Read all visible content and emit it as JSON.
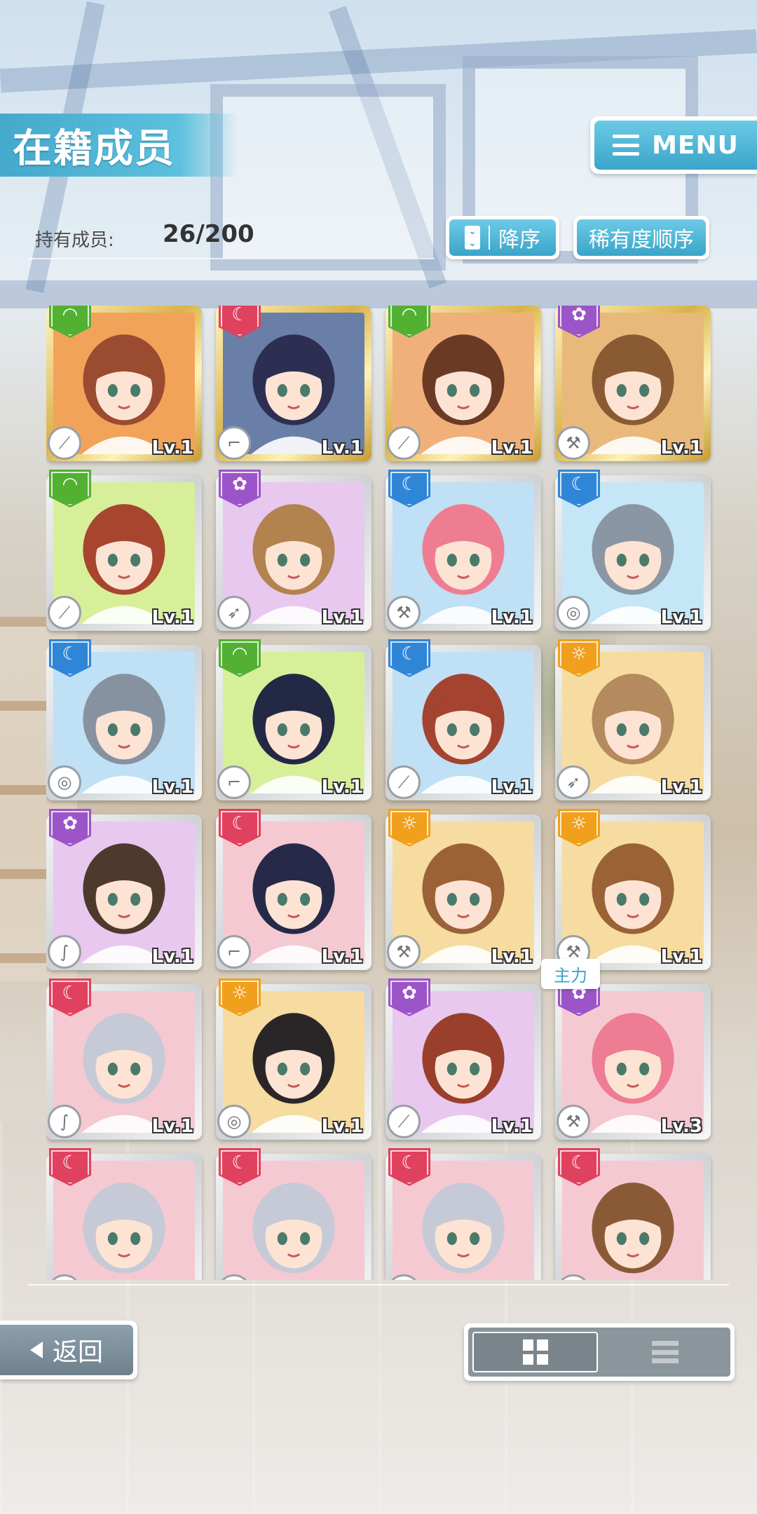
{
  "header": {
    "title": "在籍成员",
    "menu_label": "MENU"
  },
  "members": {
    "label": "持有成员:",
    "count": "26/200"
  },
  "sort": {
    "order_label": "降序",
    "criteria_label": "稀有度顺序"
  },
  "main_tag": "主力",
  "cards": [
    {
      "attr": "green",
      "frame": "gold",
      "weapon": "sword",
      "lv": "Lv.1",
      "hair": "#9a4b30",
      "bg": "#f2a35a"
    },
    {
      "attr": "red",
      "frame": "gold",
      "weapon": "gun",
      "lv": "Lv.1",
      "hair": "#2c2f52",
      "bg": "#6a7fa8"
    },
    {
      "attr": "green",
      "frame": "gold",
      "weapon": "sword",
      "lv": "Lv.1",
      "hair": "#6b3a25",
      "bg": "#f0b07a"
    },
    {
      "attr": "purple",
      "frame": "gold",
      "weapon": "hammer",
      "lv": "Lv.1",
      "hair": "#8a5a32",
      "bg": "#e9b97c"
    },
    {
      "attr": "green",
      "frame": "silver",
      "weapon": "sword",
      "lv": "Lv.1",
      "hair": "#a8452e",
      "bg": "#d8ef9a"
    },
    {
      "attr": "purple",
      "frame": "silver",
      "weapon": "lance",
      "lv": "Lv.1",
      "hair": "#b2834f",
      "bg": "#e8c8ef"
    },
    {
      "attr": "blue",
      "frame": "silver",
      "weapon": "hammer",
      "lv": "Lv.1",
      "hair": "#ef7d92",
      "bg": "#bfe0f5"
    },
    {
      "attr": "blue",
      "frame": "silver",
      "weapon": "shield",
      "lv": "Lv.1",
      "hair": "#8a96a3",
      "bg": "#c5e6f6"
    },
    {
      "attr": "blue",
      "frame": "silver",
      "weapon": "shield",
      "lv": "Lv.1",
      "hair": "#8792a0",
      "bg": "#bfe0f5"
    },
    {
      "attr": "green",
      "frame": "silver",
      "weapon": "gun",
      "lv": "Lv.1",
      "hair": "#232845",
      "bg": "#d8ef9a"
    },
    {
      "attr": "blue",
      "frame": "silver",
      "weapon": "sword",
      "lv": "Lv.1",
      "hair": "#a4432f",
      "bg": "#bfe0f5"
    },
    {
      "attr": "orange",
      "frame": "silver",
      "weapon": "lance",
      "lv": "Lv.1",
      "hair": "#b48a5e",
      "bg": "#f6dca0"
    },
    {
      "attr": "purple",
      "frame": "silver",
      "weapon": "whip",
      "lv": "Lv.1",
      "hair": "#4e3a2c",
      "bg": "#e8c8ef"
    },
    {
      "attr": "red",
      "frame": "silver",
      "weapon": "gun",
      "lv": "Lv.1",
      "hair": "#262a48",
      "bg": "#f5c9d2"
    },
    {
      "attr": "orange",
      "frame": "silver",
      "weapon": "hammer",
      "lv": "Lv.1",
      "hair": "#9a6236",
      "bg": "#f6dca0"
    },
    {
      "attr": "orange",
      "frame": "silver",
      "weapon": "hammer",
      "lv": "Lv.1",
      "hair": "#9a6236",
      "bg": "#f6dca0"
    },
    {
      "attr": "pink",
      "frame": "silver",
      "weapon": "whip",
      "lv": "Lv.1",
      "hair": "#c6cad6",
      "bg": "#f5c9d2"
    },
    {
      "attr": "orange",
      "frame": "silver",
      "weapon": "shield",
      "lv": "Lv.1",
      "hair": "#2a2628",
      "bg": "#f6dca0"
    },
    {
      "attr": "purple",
      "frame": "silver",
      "weapon": "sword",
      "lv": "Lv.1",
      "hair": "#9a3f2c",
      "bg": "#e8c8ef"
    },
    {
      "attr": "purple",
      "frame": "silver",
      "weapon": "hammer",
      "lv": "Lv.3",
      "hair": "#ee7c93",
      "bg": "#f5c9d2",
      "main": true
    },
    {
      "attr": "pink",
      "frame": "silver",
      "weapon": "whip",
      "lv": "",
      "hair": "#c6cad6",
      "bg": "#f5c9d2"
    },
    {
      "attr": "pink",
      "frame": "silver",
      "weapon": "whip",
      "lv": "",
      "hair": "#c6cad6",
      "bg": "#f5c9d2"
    },
    {
      "attr": "pink",
      "frame": "silver",
      "weapon": "whip",
      "lv": "",
      "hair": "#c6cad6",
      "bg": "#f5c9d2"
    },
    {
      "attr": "pink",
      "frame": "silver",
      "weapon": "whip",
      "lv": "",
      "hair": "#8a5a36",
      "bg": "#f5c9d2"
    }
  ],
  "footer": {
    "back_label": "返回"
  },
  "view_toggle": {
    "active": "grid-view"
  }
}
